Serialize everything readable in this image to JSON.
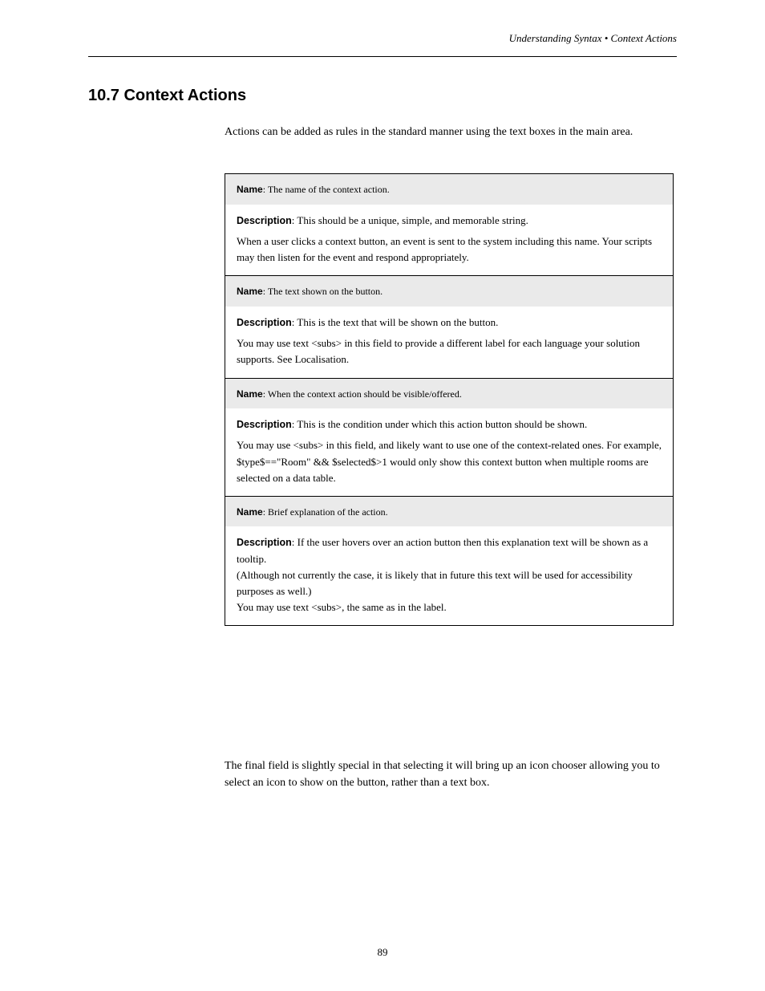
{
  "header": {
    "running_title": "Understanding Syntax • Context Actions"
  },
  "section": {
    "heading": "10.7 Context Actions",
    "intro": "Actions can be added as rules in the standard manner using the text boxes in the main area."
  },
  "items": [
    {
      "name_label": "Name",
      "name_value": "The name of the context action.",
      "description_label": "Description",
      "description_paragraphs": [
        "This should be a unique, simple, and memorable string.",
        "When a user clicks a context button, an event is sent to the system including this name. Your scripts may then listen for the event and respond appropriately."
      ]
    },
    {
      "name_label": "Name",
      "name_value": "The text shown on the button.",
      "description_label": "Description",
      "description_paragraphs": [
        "This is the text that will be shown on the button.",
        "You may use text <subs> in this field to provide a different label for each language your solution supports. See Localisation."
      ]
    },
    {
      "name_label": "Name",
      "name_value": "When the context action should be visible/offered.",
      "description_label": "Description",
      "description_paragraphs": [
        "This is the condition under which this action button should be shown.",
        "You may use <subs> in this field, and likely want to use one of the context-related ones. For example, $type$==\"Room\" && $selected$>1 would only show this context button when multiple rooms are selected on a data table."
      ]
    },
    {
      "name_label": "Name",
      "name_value": "Brief explanation of the action.",
      "description_label": "Description",
      "description_paragraphs": [
        "If the user hovers over an action button then this explanation text will be shown as a tooltip.",
        "(Although not currently the case, it is likely that in future this text will be used for accessibility purposes as well.)",
        "You may use text <subs>, the same as in the label."
      ]
    }
  ],
  "closing": "The final field is slightly special in that selecting it will bring up an icon chooser allowing you to select an icon to show on the button, rather than a text box.",
  "page_number": "89"
}
